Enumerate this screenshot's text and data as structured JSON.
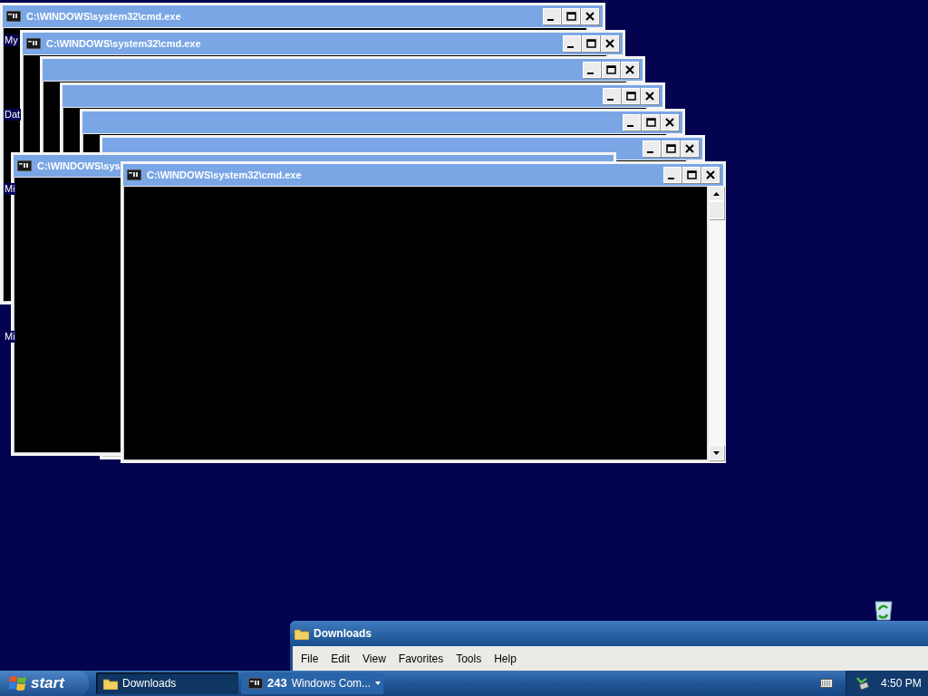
{
  "desktop_icons": [
    {
      "label": "My"
    },
    {
      "label": "Dat"
    },
    {
      "label": "Mi"
    },
    {
      "label": "Mi"
    }
  ],
  "cmd_windows": [
    {
      "kind": "console",
      "title": "C:\\WINDOWS\\system32\\cmd.exe"
    },
    {
      "kind": "console",
      "title": "C:\\WINDOWS\\system32\\cmd.exe"
    },
    {
      "kind": "console"
    },
    {
      "kind": "console"
    },
    {
      "kind": "console"
    },
    {
      "kind": "console"
    },
    {
      "kind": "console",
      "title": "C:\\WINDOWS\\sys"
    },
    {
      "kind": "console",
      "title": "C:\\WINDOWS\\system32\\cmd.exe"
    }
  ],
  "explorer_window": {
    "title": "Downloads",
    "menu": [
      "File",
      "Edit",
      "View",
      "Favorites",
      "Tools",
      "Help"
    ]
  },
  "taskbar": {
    "start": "start",
    "buttons": [
      {
        "kind": "folder",
        "label": "Downloads",
        "selected": true
      },
      {
        "kind": "group",
        "count": "243",
        "label": "Windows Com...",
        "selected": false
      }
    ],
    "clock": "4:50 PM"
  }
}
